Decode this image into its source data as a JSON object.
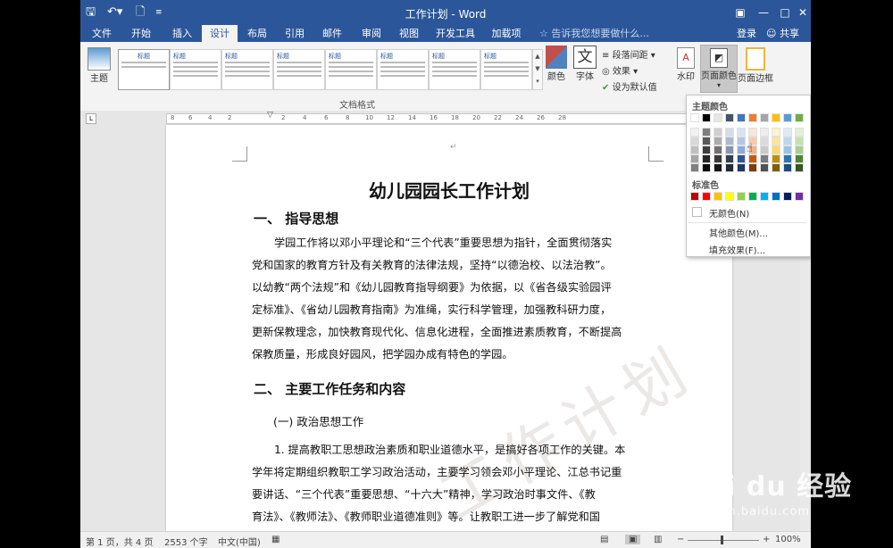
{
  "window": {
    "title": "工作计划 - Word"
  },
  "quick_access": {
    "save_icon": "save-icon",
    "undo_icon": "undo-icon",
    "new_icon": "new-doc-icon"
  },
  "tabs": [
    {
      "label": "文件"
    },
    {
      "label": "开始"
    },
    {
      "label": "插入"
    },
    {
      "label": "设计",
      "active": true
    },
    {
      "label": "布局"
    },
    {
      "label": "引用"
    },
    {
      "label": "邮件"
    },
    {
      "label": "审阅"
    },
    {
      "label": "视图"
    },
    {
      "label": "开发工具"
    },
    {
      "label": "加载项"
    }
  ],
  "tell_me": "告诉我您想要做什么...",
  "account": {
    "login": "登录",
    "share": "共享"
  },
  "ribbon": {
    "theme_label": "主题",
    "gallery_title_label": "标题",
    "gallery_item_titles": [
      "标题",
      "标题",
      "标题",
      "标题",
      "标题",
      "标题",
      "标题"
    ],
    "colors_label": "颜色",
    "fonts_label": "字体",
    "paragraph_spacing": "段落间距",
    "effects": "效果",
    "set_default": "设为默认值",
    "watermark": "水印",
    "page_color": "页面颜色",
    "page_borders": "页面边框",
    "group_label": "文档格式"
  },
  "ruler_ticks": [
    "8",
    "6",
    "4",
    "2",
    "2",
    "4",
    "6",
    "8",
    "10",
    "12",
    "14",
    "16",
    "18",
    "20",
    "22",
    "24",
    "26",
    "28"
  ],
  "document": {
    "title": "幼儿园园长工作计划",
    "heading1": "一、   指导思想",
    "para1": [
      "学园工作将以邓小平理论和“三个代表”重要思想为指针，全面贯彻落实",
      "党和国家的教育方针及有关教育的法律法规，坚持“以德治校、以法治教”。",
      "以幼教“两个法规”和《幼儿园教育指导纲要》为依据，以《省各级实验园评",
      "定标准》、《省幼儿园教育指南》为准绳，实行科学管理，加强教科研力度，",
      "更新保教理念，加快教育现代化、信息化进程，全面推进素质教育，不断提高",
      "保教质量，形成良好园风，把学园办成有特色的学园。"
    ],
    "heading2": "二、   主要工作任务和内容",
    "sub1": "(一) 政治思想工作",
    "para2": [
      "1. 提高教职工思想政治素质和职业道德水平，是搞好各项工作的关键。本",
      "学年将定期组织教职工学习政治活动，主要学习领会邓小平理论、江总书记重",
      "要讲话、“三个代表”重要思想、“十六大”精神，学习政治时事文件、《教",
      "育法》、《教师法》、《教师职业道德准则》等。让教职工进一步了解党和国"
    ]
  },
  "page_color_panel": {
    "theme_colors_label": "主题颜色",
    "standard_colors_label": "标准色",
    "no_color": "无颜色(N)",
    "more_colors": "其他颜色(M)...",
    "fill_effects": "填充效果(F)...",
    "theme_top_row": [
      "#ffffff",
      "#000000",
      "#e7e6e6",
      "#44546a",
      "#4472c4",
      "#ed7d31",
      "#a5a5a5",
      "#ffc000",
      "#5b9bd5",
      "#70ad47"
    ],
    "theme_shades": [
      [
        "#f2f2f2",
        "#7f7f7f",
        "#d0cece",
        "#d6dce4",
        "#d9e2f3",
        "#fbe5d5",
        "#ededed",
        "#fff2cc",
        "#deebf6",
        "#e2efd9"
      ],
      [
        "#d8d8d8",
        "#595959",
        "#aeabab",
        "#adb9ca",
        "#b4c6e7",
        "#f7cbac",
        "#dbdbdb",
        "#fee599",
        "#bdd7ee",
        "#c5e0b3"
      ],
      [
        "#bfbfbf",
        "#3f3f3f",
        "#757070",
        "#8496b0",
        "#8eaadb",
        "#f4b183",
        "#c9c9c9",
        "#ffd965",
        "#9cc3e5",
        "#a8d08d"
      ],
      [
        "#a5a5a5",
        "#262626",
        "#3a3838",
        "#323f4f",
        "#2f5496",
        "#c55a11",
        "#7b7b7b",
        "#bf8f00",
        "#2e75b5",
        "#538135"
      ],
      [
        "#7f7f7f",
        "#0c0c0c",
        "#171616",
        "#222a35",
        "#1f3864",
        "#833c0b",
        "#525252",
        "#7f6000",
        "#1e4e79",
        "#375623"
      ]
    ],
    "standard_row": [
      "#c00000",
      "#ff0000",
      "#ffc000",
      "#ffff00",
      "#92d050",
      "#00b050",
      "#00b0f0",
      "#0070c0",
      "#002060",
      "#7030a0"
    ]
  },
  "status_bar": {
    "page": "第 1 页，共 4 页",
    "words": "2553 个字",
    "language": "中文(中国)",
    "zoom": "100%"
  },
  "overlay": {
    "logo_text": "Bai du 经验",
    "url": "jingyan.baidu.com"
  }
}
